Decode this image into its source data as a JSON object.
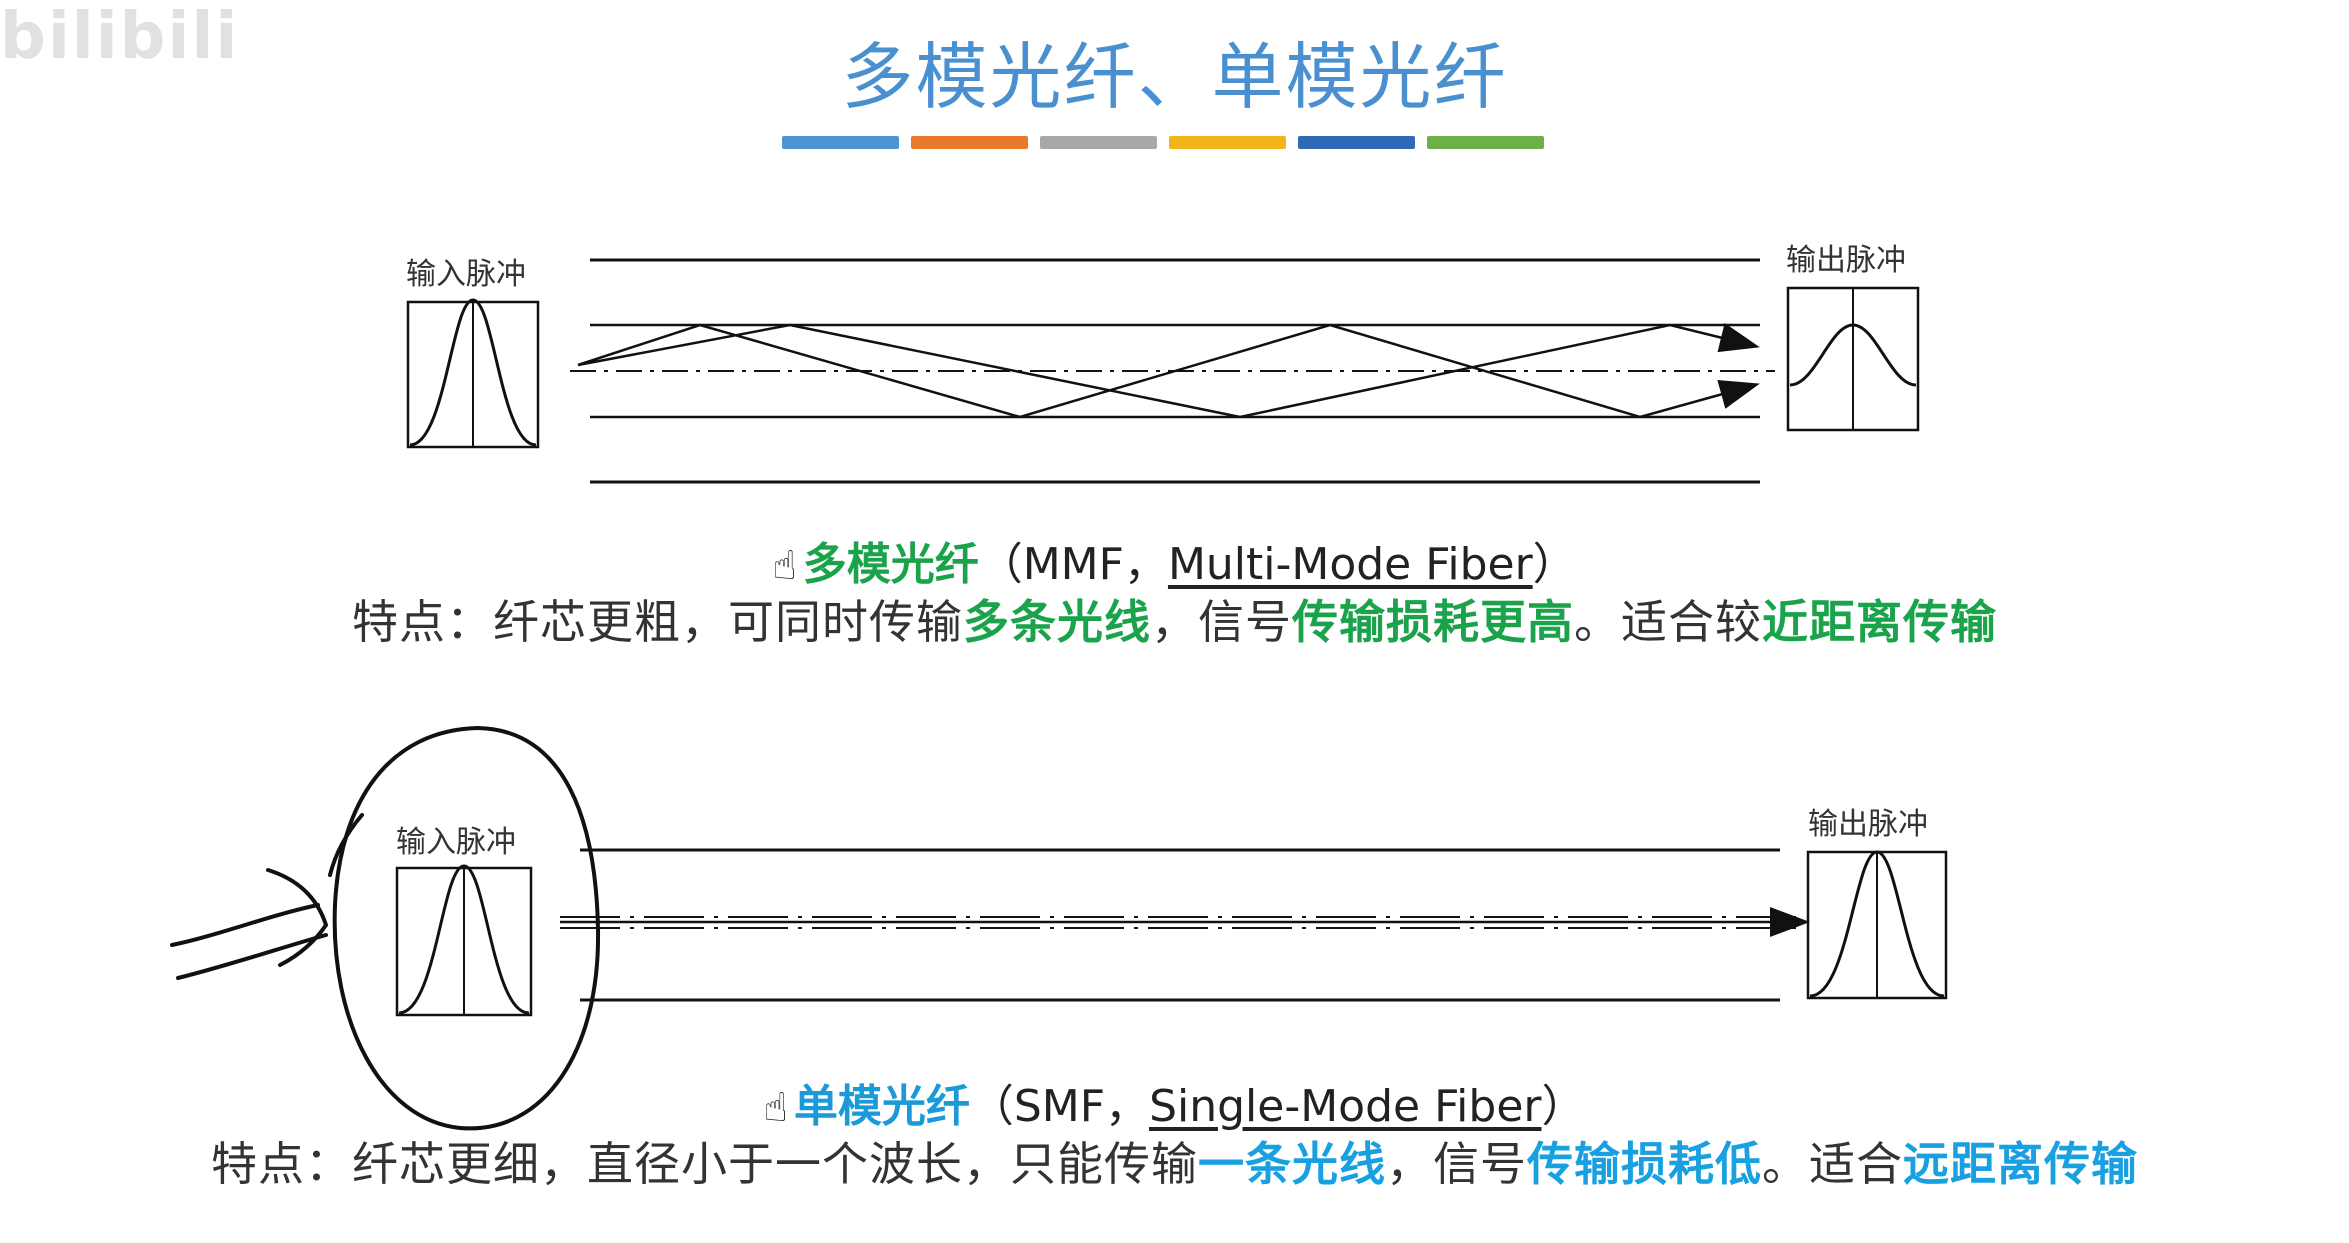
{
  "watermark": "bilibili",
  "title": "多模光纤、单模光纤",
  "color_bars": [
    "#4e94d4",
    "#e87a2a",
    "#a8a8a8",
    "#f2b51c",
    "#2f6ab8",
    "#6cb04a"
  ],
  "mmf": {
    "input_label": "输入脉冲",
    "output_label": "输出脉冲",
    "caption": {
      "hand_icon": "☝",
      "name": "多模光纤",
      "open": "（MMF，",
      "english": "Multi-Mode Fiber",
      "close": "）"
    },
    "feature": {
      "t1": "特点：纤芯更粗，可同时传输",
      "h1": "多条光线",
      "t2": "，信号",
      "h2": "传输损耗更高",
      "t3": "。适合较",
      "h3": "近距离传输"
    }
  },
  "smf": {
    "input_label": "输入脉冲",
    "output_label": "输出脉冲",
    "caption": {
      "hand_icon": "☝",
      "name": "单模光纤",
      "open": "（SMF，",
      "english": "Single-Mode Fiber",
      "close": "）"
    },
    "feature": {
      "t1": "特点：纤芯更细，直径小于一个波长，只能传输",
      "h1": "一条光线",
      "t2": "，信号",
      "h2": "传输损耗低",
      "t3": "。适合",
      "h3": "远距离传输"
    }
  }
}
